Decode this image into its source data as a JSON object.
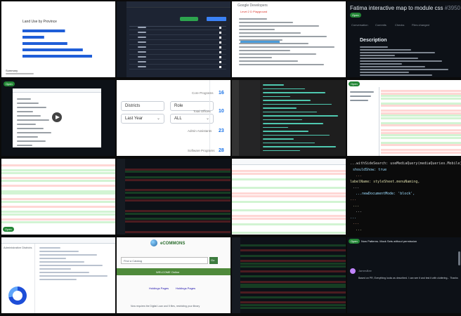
{
  "tiles": {
    "chart_tile": {
      "chart_title": "Land Use by Province",
      "footer_title": "Summary",
      "chart_data": {
        "type": "bar",
        "orientation": "horizontal",
        "categories": [
          "",
          "",
          "",
          "",
          ""
        ],
        "values": [
          55,
          28,
          58,
          78,
          90
        ],
        "xlim": [
          0,
          100
        ]
      }
    },
    "data_table_tile": {
      "header_labels": [
        "Exporter Analysis",
        "Export CSV"
      ]
    },
    "google_dev_tile": {
      "brand": "Google Developers",
      "subtitle": "Level 2 D Playground"
    },
    "pr_title_tile": {
      "title": "Fatima interactive map to module css",
      "number": "#3950",
      "status": "Open",
      "section_heading": "Description",
      "tabs": [
        "Conversation",
        "Commits",
        "Checks",
        "Files changed"
      ]
    },
    "video_pr_tile": {
      "status": "Open"
    },
    "filters_tile": {
      "filter_label": "Districts",
      "role_label": "Role",
      "period_value": "Last Year",
      "role_value": "ALL",
      "stats": [
        {
          "label": "Core Programs",
          "value": "16"
        },
        {
          "label": "Total Offices",
          "value": "10"
        },
        {
          "label": "Admin Assistants",
          "value": "23"
        },
        {
          "label": "Software Programs",
          "value": "28"
        }
      ]
    },
    "editor_tile": {},
    "split_diff_tile": {
      "status": "Open"
    },
    "diff_light_tile": {
      "status": "Open"
    },
    "dark_diff_tile": {},
    "light_diff_tile_2": {},
    "big_code_tile": {
      "lines": [
        "...withSideSearch: useMediaQuery(mediaQueries.Mobile)",
        "shouldShow: true",
        "...",
        "labelName: styleSheet.menuNaming,",
        "...",
        "...newDocumentMode: 'block',",
        "...",
        "...",
        "...",
        "...",
        "...",
        "..."
      ]
    },
    "dashboard_tile": {
      "sidebar_title": "Administrative Districts"
    },
    "library_tile": {
      "brand": "eCOMMONS",
      "search_placeholder": "Find a Catalog",
      "search_button": "Go",
      "tagline": "WELCOME Online",
      "link_left": "Holdings Pages",
      "link_right": "Holdings Pages",
      "footer_text": "Now requires the Digital Loan and 5 files, restricting your library"
    },
    "dark_diff_tile_2": {},
    "comment_tile": {
      "title": "Now Patterns. Mock Sets without permission",
      "status": "Open",
      "comment_text": "Based on PR, Everything looks as described. I can see it and test it with cluttering... Thanks",
      "author": "JamesBee"
    }
  },
  "colors": {
    "github_green": "#238636",
    "link_blue": "#1a73e8",
    "diff_add_light": "#d2f4d3",
    "diff_del_light": "#ffd7d5"
  }
}
